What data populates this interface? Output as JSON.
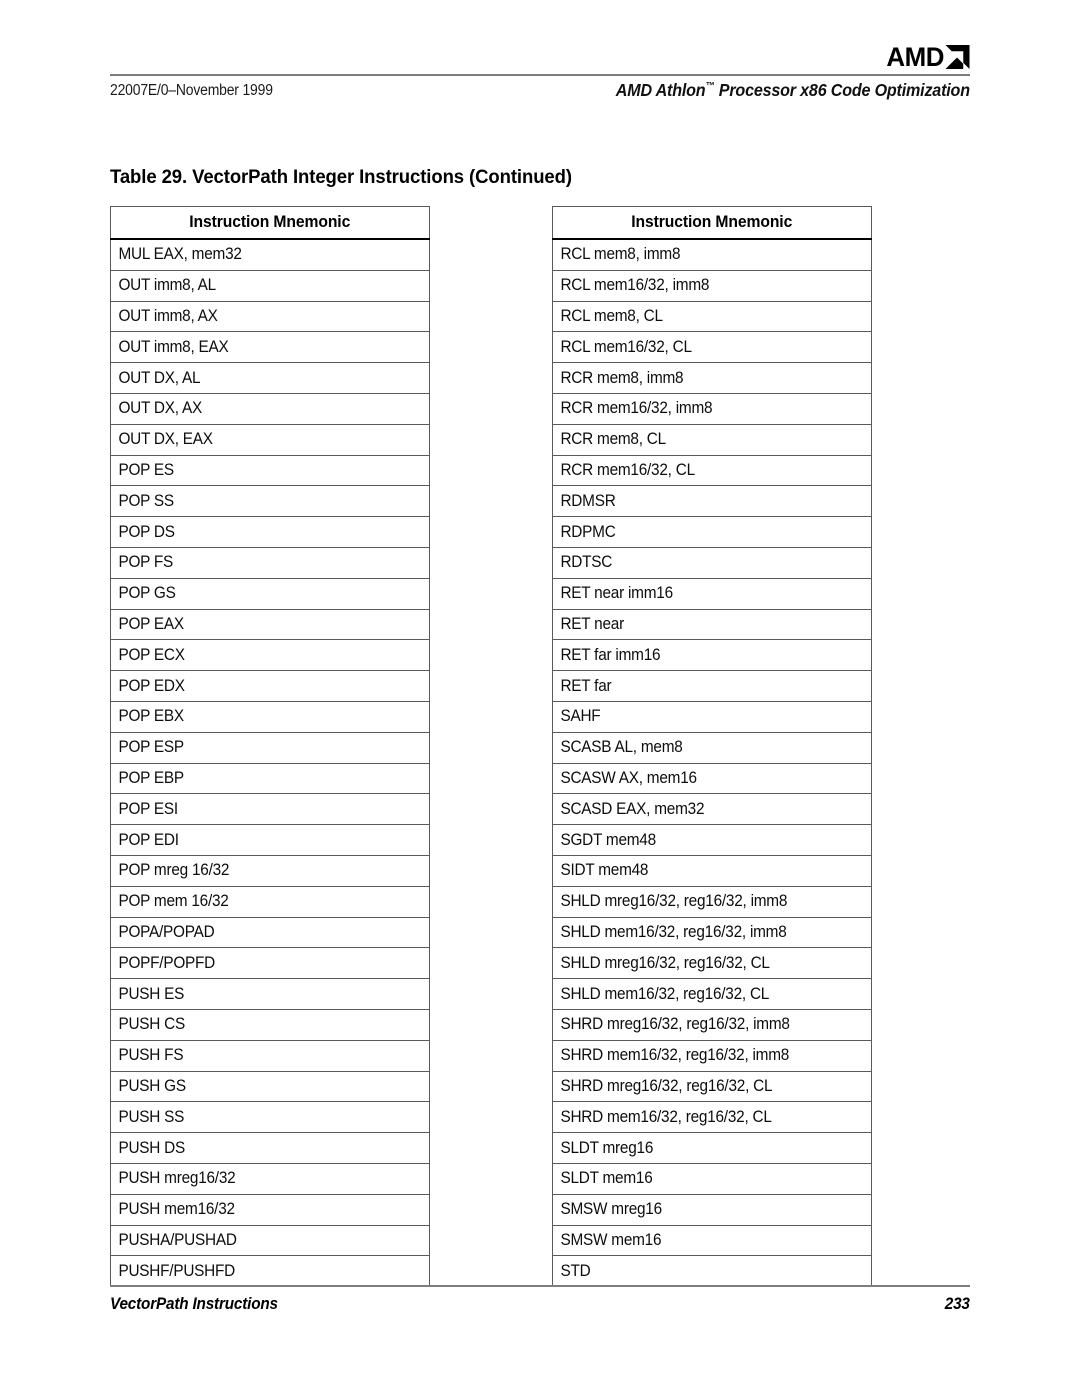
{
  "header": {
    "logo_text": "AMD",
    "logo_icon": "amd-arrow-icon",
    "doc_id": "22007E/0–November 1999",
    "title": "AMD Athlon",
    "title_tm": "™",
    "title_rest": " Processor x86 Code Optimization"
  },
  "table_title": "Table 29. VectorPath Integer Instructions (Continued)",
  "tables": [
    {
      "id": "left",
      "header": "Instruction Mnemonic",
      "rows": [
        "MUL EAX, mem32",
        "OUT imm8, AL",
        "OUT imm8, AX",
        "OUT imm8, EAX",
        "OUT DX, AL",
        "OUT DX, AX",
        "OUT DX, EAX",
        "POP ES",
        "POP SS",
        "POP DS",
        "POP FS",
        "POP GS",
        "POP EAX",
        "POP ECX",
        "POP EDX",
        "POP EBX",
        "POP ESP",
        "POP EBP",
        "POP ESI",
        "POP EDI",
        "POP mreg 16/32",
        "POP mem 16/32",
        "POPA/POPAD",
        "POPF/POPFD",
        "PUSH ES",
        "PUSH CS",
        "PUSH FS",
        "PUSH GS",
        "PUSH SS",
        "PUSH DS",
        "PUSH mreg16/32",
        "PUSH mem16/32",
        "PUSHA/PUSHAD",
        "PUSHF/PUSHFD"
      ]
    },
    {
      "id": "right",
      "header": "Instruction Mnemonic",
      "rows": [
        "RCL mem8, imm8",
        "RCL mem16/32, imm8",
        "RCL mem8, CL",
        "RCL mem16/32, CL",
        "RCR mem8, imm8",
        "RCR mem16/32, imm8",
        "RCR mem8, CL",
        "RCR mem16/32, CL",
        "RDMSR",
        "RDPMC",
        "RDTSC",
        "RET near imm16",
        "RET near",
        "RET far imm16",
        "RET far",
        "SAHF",
        "SCASB AL, mem8",
        "SCASW AX, mem16",
        "SCASD EAX, mem32",
        "SGDT mem48",
        "SIDT mem48",
        "SHLD mreg16/32, reg16/32, imm8",
        "SHLD mem16/32, reg16/32, imm8",
        "SHLD mreg16/32, reg16/32, CL",
        "SHLD mem16/32, reg16/32, CL",
        "SHRD mreg16/32, reg16/32, imm8",
        "SHRD mem16/32, reg16/32, imm8",
        "SHRD mreg16/32, reg16/32, CL",
        "SHRD mem16/32, reg16/32, CL",
        "SLDT mreg16",
        "SLDT mem16",
        "SMSW mreg16",
        "SMSW mem16",
        "STD"
      ]
    }
  ],
  "footer": {
    "section": "VectorPath Instructions",
    "page_number": "233"
  },
  "colors": {
    "text": "#000000",
    "rule": "#7d7d7d",
    "table_border": "#58595b",
    "header_underline": "#000000"
  }
}
